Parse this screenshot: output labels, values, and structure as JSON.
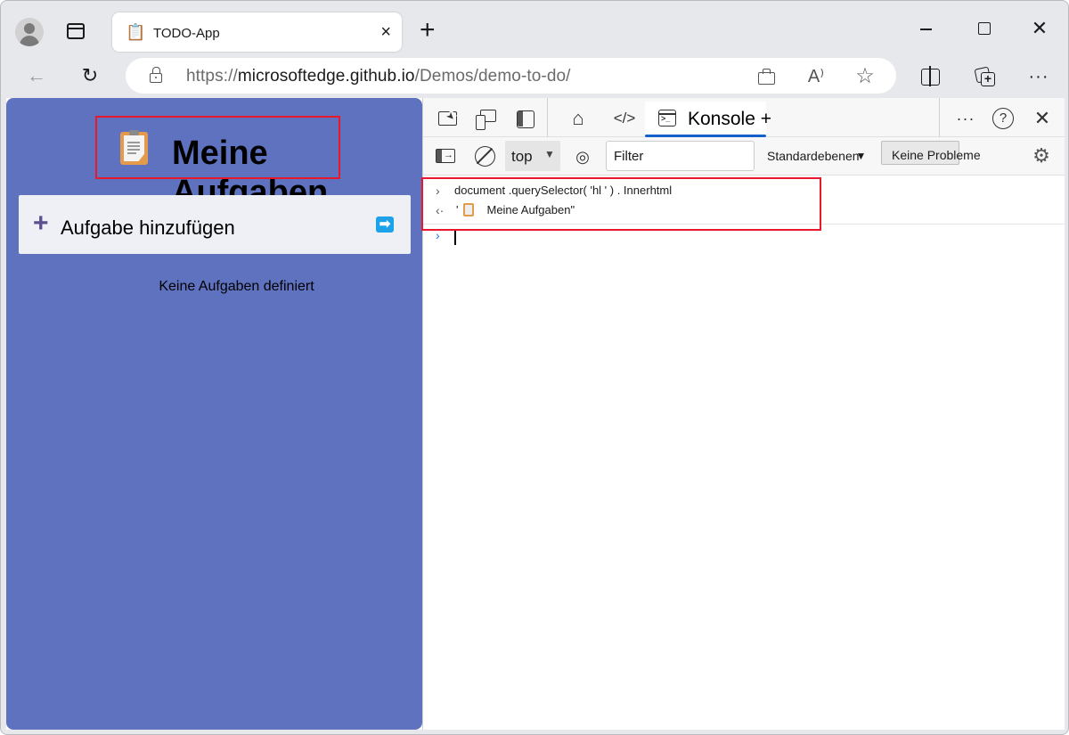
{
  "browser": {
    "tab": {
      "favicon": "clipboard-icon",
      "title": "TODO-App",
      "close": "×"
    },
    "new_tab": "+",
    "window_controls": {
      "close": "✕"
    },
    "nav": {
      "back": "←",
      "refresh": "↻"
    },
    "address": {
      "scheme": "https://",
      "host": "microsoftedge.github.io",
      "path": "/Demos/demo-to-do/"
    },
    "omnibox_icons": {
      "read_aloud": "A⁾",
      "favorite": "☆"
    },
    "toolbar": {
      "more": "···"
    }
  },
  "todo_app": {
    "title": "Meine Aufgaben",
    "add_task": {
      "plus": "+",
      "label": "Aufgabe hinzufügen",
      "submit": "➡"
    },
    "empty_message": "Keine Aufgaben definiert",
    "accent_color": "#5f72c0"
  },
  "devtools": {
    "tabs": {
      "home": "⌂",
      "elements": "</>",
      "console_label": "Konsole +",
      "more": "···",
      "close": "✕"
    },
    "toolbar": {
      "context": "top",
      "context_caret": "▼",
      "eye": "◎",
      "filter_value": "Filter",
      "levels": "Standardebenen",
      "levels_caret": "▼",
      "issues": "Keine Probleme",
      "settings": "⚙"
    },
    "console": {
      "lines": [
        {
          "type": "input",
          "gutter": "›",
          "text": "document .querySelector( 'hl ' ) . Innerhtml"
        },
        {
          "type": "output",
          "gutter": "‹·",
          "prefix": "'",
          "text": "Meine Aufgaben\""
        }
      ],
      "prompt": "›"
    },
    "highlight_color": "#e8192c"
  }
}
